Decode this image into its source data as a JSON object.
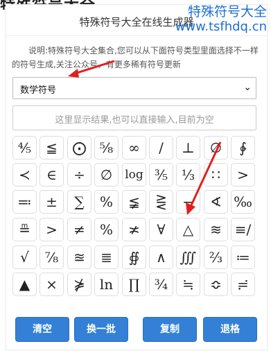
{
  "header_strip": "特殊符号大全，",
  "watermark": {
    "line1": "特殊符号大全",
    "line2": "www.tsfhdq.cn"
  },
  "panel": {
    "title": "特殊符号大全在线生成器",
    "description": "说明:特殊符号大全集合,您可以从下面符号类型里面选择不一样的符号生成,关注公众号，有更多稀有符号更新",
    "select_value": "数学符号",
    "result_placeholder": "这里显示结果,也可以直接输入,目前为空"
  },
  "symbols": [
    [
      "⅘",
      "≦",
      "⨀",
      "⅝",
      "∞",
      "∕",
      "⊥",
      "∅",
      "∲"
    ],
    [
      "≺",
      "∈",
      "÷",
      "∅",
      "log",
      "⅗",
      "⅓",
      "∷",
      ">"
    ],
    [
      "≕",
      "±",
      "∑",
      "%",
      "≨",
      "⋛",
      "−",
      "∢",
      "‰"
    ],
    [
      "≞",
      ">",
      "≠",
      "%",
      "≭",
      "∀",
      "△",
      "≋",
      "≡/"
    ],
    [
      "√",
      "⅞",
      "≊",
      "≣",
      "∯",
      "∧",
      "∭",
      "⅔",
      "≔"
    ],
    [
      "▲",
      "×",
      "⋡",
      "ln",
      "∏",
      "¾",
      "≒",
      "≎",
      "≓"
    ]
  ],
  "buttons": [
    "清空",
    "换一批",
    "复制",
    "退格"
  ],
  "colors": {
    "button": "#3380d6",
    "watermark": "#1e6fd1",
    "arrow": "#e02020"
  }
}
